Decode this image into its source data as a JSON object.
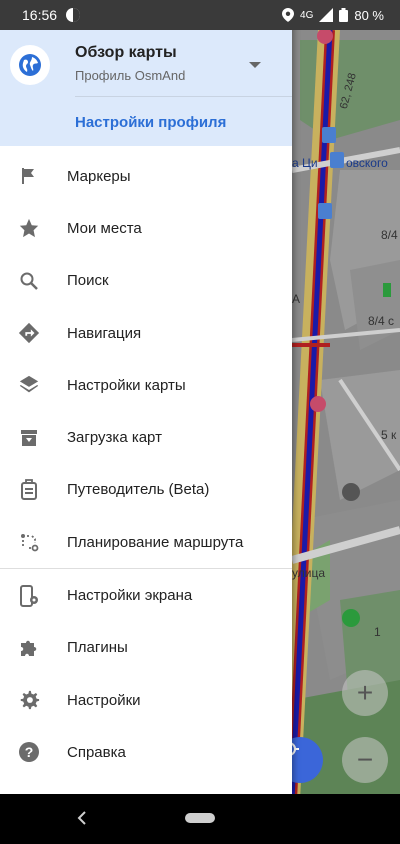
{
  "status_bar": {
    "time": "16:56",
    "network": "4G",
    "battery": "80 %"
  },
  "drawer": {
    "profile": {
      "title": "Обзор карты",
      "subtitle": "Профиль OsmAnd",
      "settings_link": "Настройки профиля",
      "icon": "globe-icon"
    },
    "items": [
      {
        "label": "Маркеры",
        "icon": "flag-icon"
      },
      {
        "label": "Мои места",
        "icon": "star-icon"
      },
      {
        "label": "Поиск",
        "icon": "search-icon"
      },
      {
        "label": "Навигация",
        "icon": "navigation-icon"
      },
      {
        "label": "Настройки карты",
        "icon": "layers-icon"
      },
      {
        "label": "Загрузка карт",
        "icon": "download-box-icon"
      },
      {
        "label": "Путеводитель (Beta)",
        "icon": "travel-guide-icon"
      },
      {
        "label": "Планирование маршрута",
        "icon": "route-planning-icon"
      },
      {
        "label": "Настройки экрана",
        "icon": "screen-settings-icon"
      },
      {
        "label": "Плагины",
        "icon": "puzzle-icon"
      },
      {
        "label": "Настройки",
        "icon": "gear-icon"
      },
      {
        "label": "Справка",
        "icon": "help-icon"
      }
    ]
  },
  "map": {
    "labels": [
      "62, 248",
      "а Ци",
      "овского",
      "8/4",
      "А",
      "8/4 с",
      "5 к",
      "улица",
      "1"
    ],
    "zoom_in": "+",
    "zoom_out": "−"
  },
  "colors": {
    "header_bg": "#dce9fb",
    "accent": "#2c6fd6",
    "icon": "#6b6b6b"
  }
}
